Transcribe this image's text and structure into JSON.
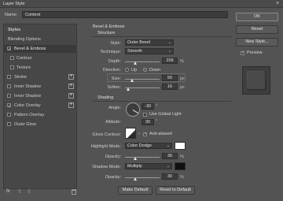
{
  "window": {
    "title": "Layer Style",
    "close_glyph": "×"
  },
  "name_field": {
    "label": "Name:",
    "value": "Content"
  },
  "buttons": {
    "ok": "OK",
    "reset": "Reset",
    "new_style": "New Style...",
    "preview": "Preview",
    "make_default": "Make Default",
    "reset_default": "Reset to Default"
  },
  "left_panel": {
    "items": [
      {
        "label": "Styles"
      },
      {
        "label": "Blending Options"
      },
      {
        "label": "Bevel & Emboss",
        "checked": true,
        "selected": true
      },
      {
        "label": "Contour",
        "checked": false
      },
      {
        "label": "Texture",
        "checked": false
      },
      {
        "label": "Stroke",
        "checked": false,
        "plus": true
      },
      {
        "label": "Inner Shadow",
        "checked": false,
        "plus": true
      },
      {
        "label": "Inner Shadow",
        "checked": false,
        "plus": true
      },
      {
        "label": "Color Overlay",
        "checked": true,
        "plus": true
      },
      {
        "label": "Pattern Overlay",
        "checked": false
      },
      {
        "label": "Outer Glow",
        "checked": false
      }
    ],
    "footer": {
      "fx": "fx",
      "up": "⇧",
      "down": "⇩",
      "trash": "🗑"
    }
  },
  "bevel": {
    "section": "Bevel & Emboss",
    "structure": "Structure",
    "style_label": "Style:",
    "style_value": "Outer Bevel",
    "technique_label": "Technique:",
    "technique_value": "Smooth",
    "depth_label": "Depth:",
    "depth_value": "209",
    "depth_unit": "%",
    "depth_level": 0.3,
    "direction_label": "Direction:",
    "dir_up": "Up",
    "dir_down": "Down",
    "size_label": "Size:",
    "size_value": "50",
    "size_unit": "px",
    "size_level": 0.2,
    "soften_label": "Soften:",
    "soften_value": "16",
    "soften_unit": "px",
    "soften_level": 0.1
  },
  "shading": {
    "section": "Shading",
    "angle_label": "Angle:",
    "angle_value": "-30",
    "angle_unit": "°",
    "global_light": "Use Global Light",
    "altitude_label": "Altitude:",
    "altitude_value": "30",
    "altitude_unit": "°",
    "gloss_label": "Gloss Contour:",
    "anti_aliased": "Anti-aliased",
    "highlight_label": "Highlight Mode:",
    "highlight_value": "Color Dodge",
    "highlight_color": "#ffffff",
    "hl_opacity_label": "Opacity:",
    "hl_opacity_value": "30",
    "hl_opacity_unit": "%",
    "hl_opacity_level": 0.3,
    "shadow_label": "Shadow Mode:",
    "shadow_value": "Multiply",
    "shadow_color": "#111111",
    "sh_opacity_label": "Opacity:",
    "sh_opacity_value": "30",
    "sh_opacity_unit": "%",
    "sh_opacity_level": 0.3
  }
}
